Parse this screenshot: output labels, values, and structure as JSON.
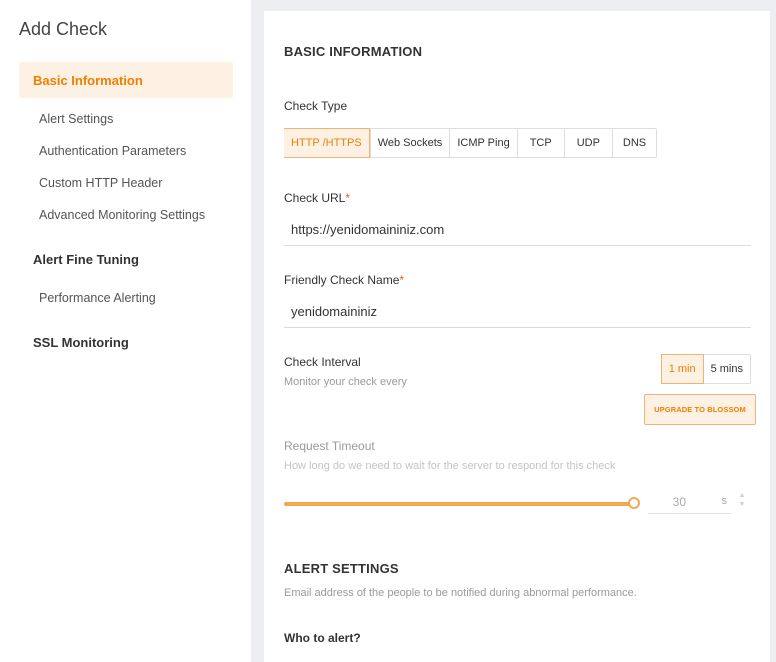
{
  "sidebar": {
    "title": "Add Check",
    "active": "Basic Information",
    "basic_items": [
      "Alert Settings",
      "Authentication Parameters",
      "Custom HTTP Header",
      "Advanced Monitoring Settings"
    ],
    "fine_tuning": "Alert Fine Tuning",
    "fine_items": [
      "Performance Alerting"
    ],
    "ssl": "SSL Monitoring"
  },
  "basic": {
    "heading": "BASIC INFORMATION",
    "check_type_label": "Check Type",
    "check_types": [
      "HTTP /HTTPS",
      "Web Sockets",
      "ICMP Ping",
      "TCP",
      "UDP",
      "DNS"
    ],
    "selected_check_type": "HTTP /HTTPS",
    "check_url_label": "Check URL",
    "check_url_value": "https://yenidomaininiz.com",
    "friendly_name_label": "Friendly Check Name",
    "friendly_name_value": "yenidomaininiz",
    "required_mark": "*",
    "interval_label": "Check Interval",
    "interval_hint": "Monitor your check every",
    "interval_options": [
      "1 min",
      "5 mins"
    ],
    "interval_selected": "1 min",
    "upgrade_label": "UPGRADE TO BLOSSOM",
    "timeout_label": "Request Timeout",
    "timeout_hint": "How long do we need to wait for the server to respond for this check",
    "timeout_value": "30",
    "timeout_unit": "s",
    "timeout_slider_level": 1.0
  },
  "alert": {
    "heading": "ALERT SETTINGS",
    "hint": "Email address of the people to be notified during abnormal performance.",
    "who_label": "Who to alert?"
  },
  "colors": {
    "accent": "#f07f00",
    "accent_bg": "#fdf1e4",
    "slider": "#f5a650"
  }
}
